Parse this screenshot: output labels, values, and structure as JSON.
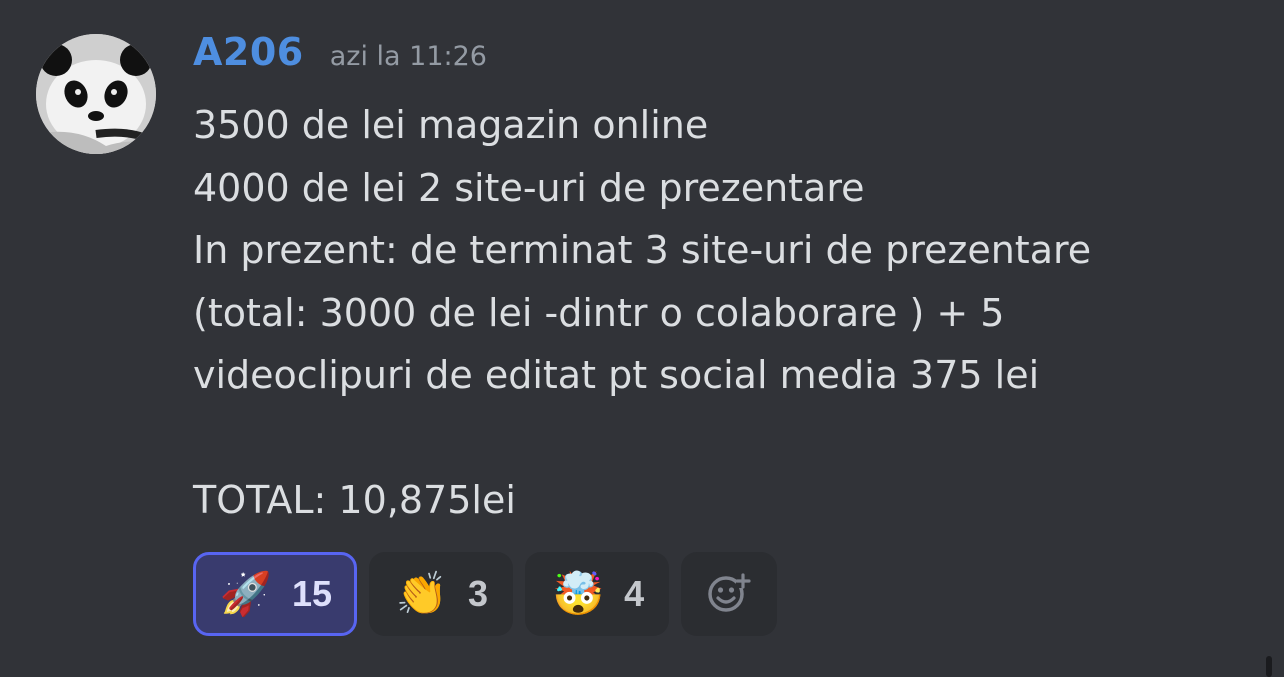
{
  "message": {
    "author": "A206",
    "timestamp": "azi la 11:26",
    "author_color": "#4e8ee0",
    "avatar_icon": "panda-avatar",
    "lines": [
      "3500 de lei magazin online",
      "4000 de lei 2 site-uri de prezentare",
      "In prezent: de terminat 3 site-uri de prezentare",
      "(total: 3000 de lei -dintr o colaborare ) + 5",
      "videoclipuri de editat pt social media 375 lei",
      "",
      "TOTAL: 10,875lei"
    ]
  },
  "reactions": [
    {
      "emoji": "🚀",
      "icon": "rocket-icon",
      "count": "15",
      "active": true
    },
    {
      "emoji": "👏",
      "icon": "clapping-hands-icon",
      "count": "3",
      "active": false
    },
    {
      "emoji": "🤯",
      "icon": "exploding-head-icon",
      "count": "4",
      "active": false
    }
  ],
  "add_reaction_icon": "add-reaction-icon",
  "colors": {
    "background": "#313338",
    "active_reaction_bg": "#393b6e",
    "active_reaction_border": "#5865f2"
  }
}
